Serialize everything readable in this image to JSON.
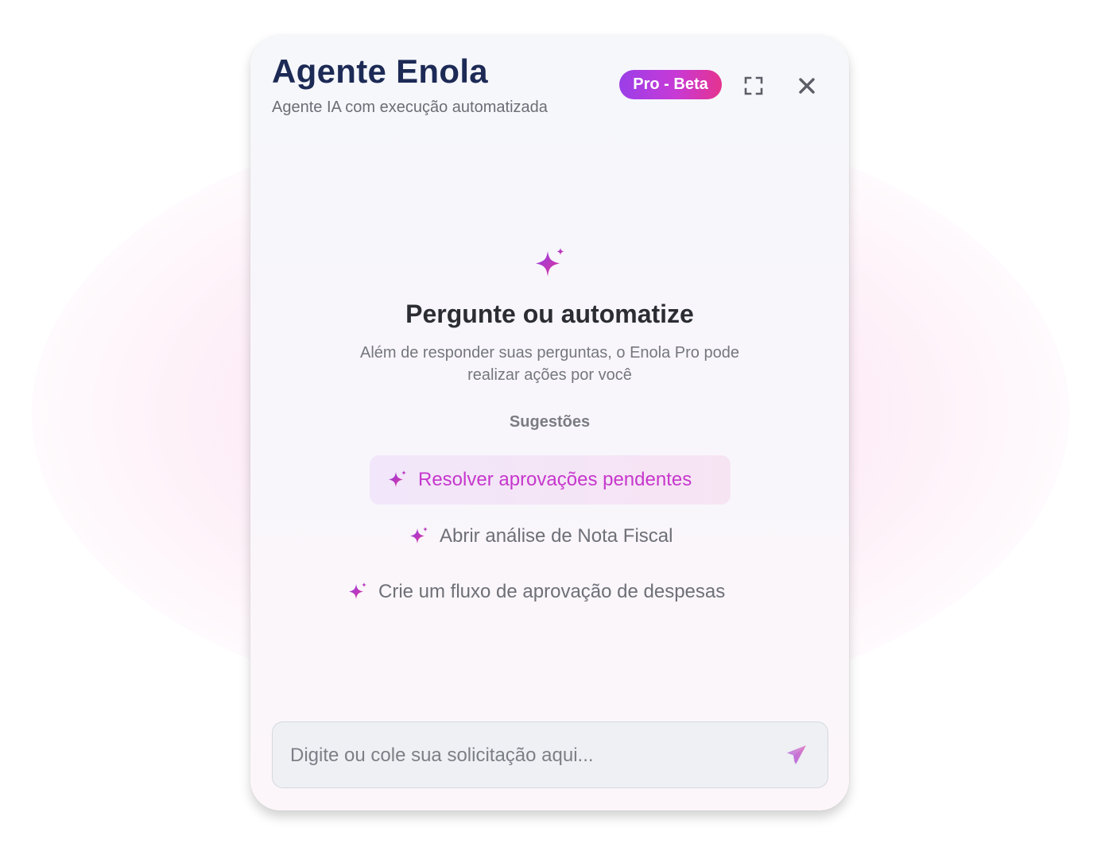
{
  "header": {
    "title": "Agente Enola",
    "subtitle": "Agente IA com execução automatizada",
    "badge": "Pro - Beta"
  },
  "icons": {
    "expand": "expand-icon",
    "close": "close-icon",
    "hero": "sparkle-icon",
    "send": "send-icon"
  },
  "empty_state": {
    "heading": "Pergunte ou automatize",
    "description_lines": [
      "Além de responder suas perguntas, o Enola Pro pode",
      "realizar ações por você"
    ]
  },
  "suggestions": {
    "label": "Sugestões",
    "items": [
      {
        "label": "Resolver aprovações pendentes"
      },
      {
        "label": "Abrir análise de Nota Fiscal"
      },
      {
        "label": "Crie um fluxo de aprovação de despesas"
      }
    ]
  },
  "composer": {
    "placeholder": "Digite ou cole sua solicitação aqui...",
    "value": ""
  },
  "colors": {
    "title": "#1c2a55",
    "accent_purple": "#9b3ee8",
    "accent_pink": "#e5338f",
    "active_suggestion_text": "#c637cc"
  }
}
